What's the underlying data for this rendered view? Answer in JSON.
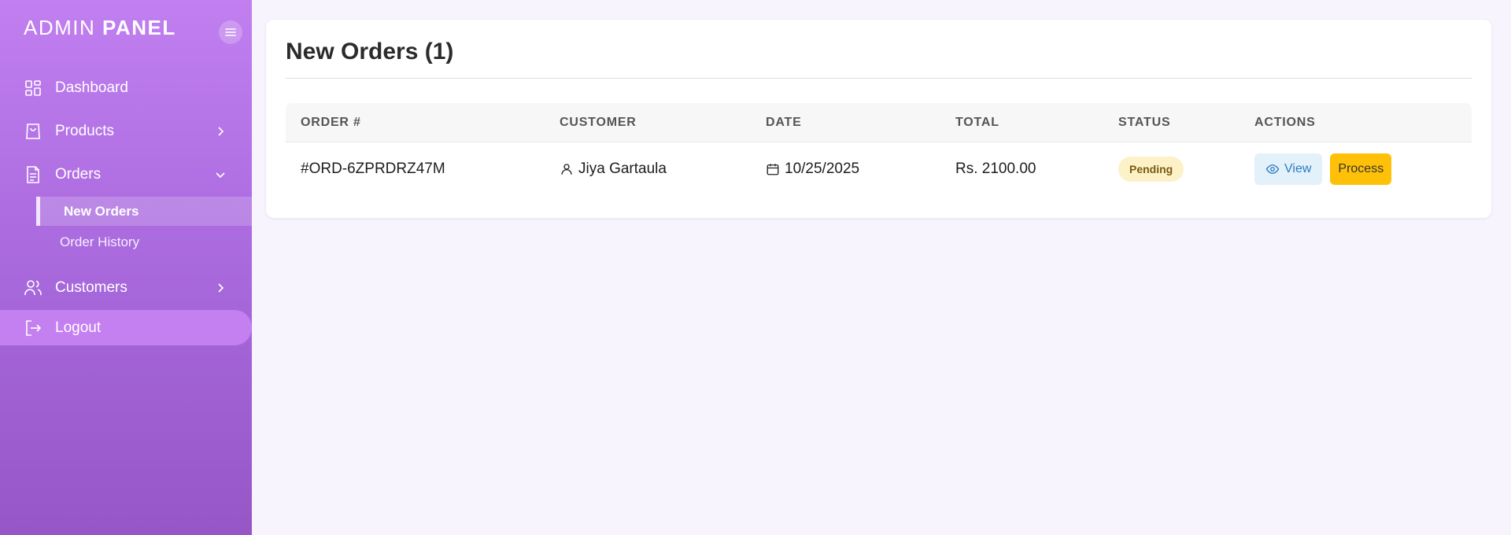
{
  "brand": {
    "light": "ADMIN",
    "bold": "PANEL"
  },
  "sidebar": {
    "toggle_icon": "menu-icon",
    "items": [
      {
        "label": "Dashboard",
        "icon": "grid-icon"
      },
      {
        "label": "Products",
        "icon": "shopping-bag-icon"
      },
      {
        "label": "Orders",
        "icon": "document-icon"
      },
      {
        "label": "Customers",
        "icon": "users-icon"
      }
    ],
    "orders_submenu": [
      {
        "label": "New Orders",
        "active": true
      },
      {
        "label": "Order History",
        "active": false
      }
    ],
    "logout": {
      "label": "Logout",
      "icon": "logout-icon"
    }
  },
  "main": {
    "title": "New Orders (1)",
    "columns": [
      "ORDER #",
      "CUSTOMER",
      "DATE",
      "TOTAL",
      "STATUS",
      "ACTIONS"
    ],
    "rows": [
      {
        "order": "#ORD-6ZPRDRZ47M",
        "customer": "Jiya Gartaula",
        "date": "10/25/2025",
        "total": "Rs. 2100.00",
        "status": "Pending"
      }
    ],
    "actions": {
      "view": "View",
      "process": "Process"
    }
  },
  "colors": {
    "sidebar_top": "#c17ff0",
    "sidebar_bottom": "#9656c6",
    "status_pending_bg": "#fdf1c7",
    "process_button": "#ffc107",
    "view_button_bg": "#e3f1fb"
  }
}
